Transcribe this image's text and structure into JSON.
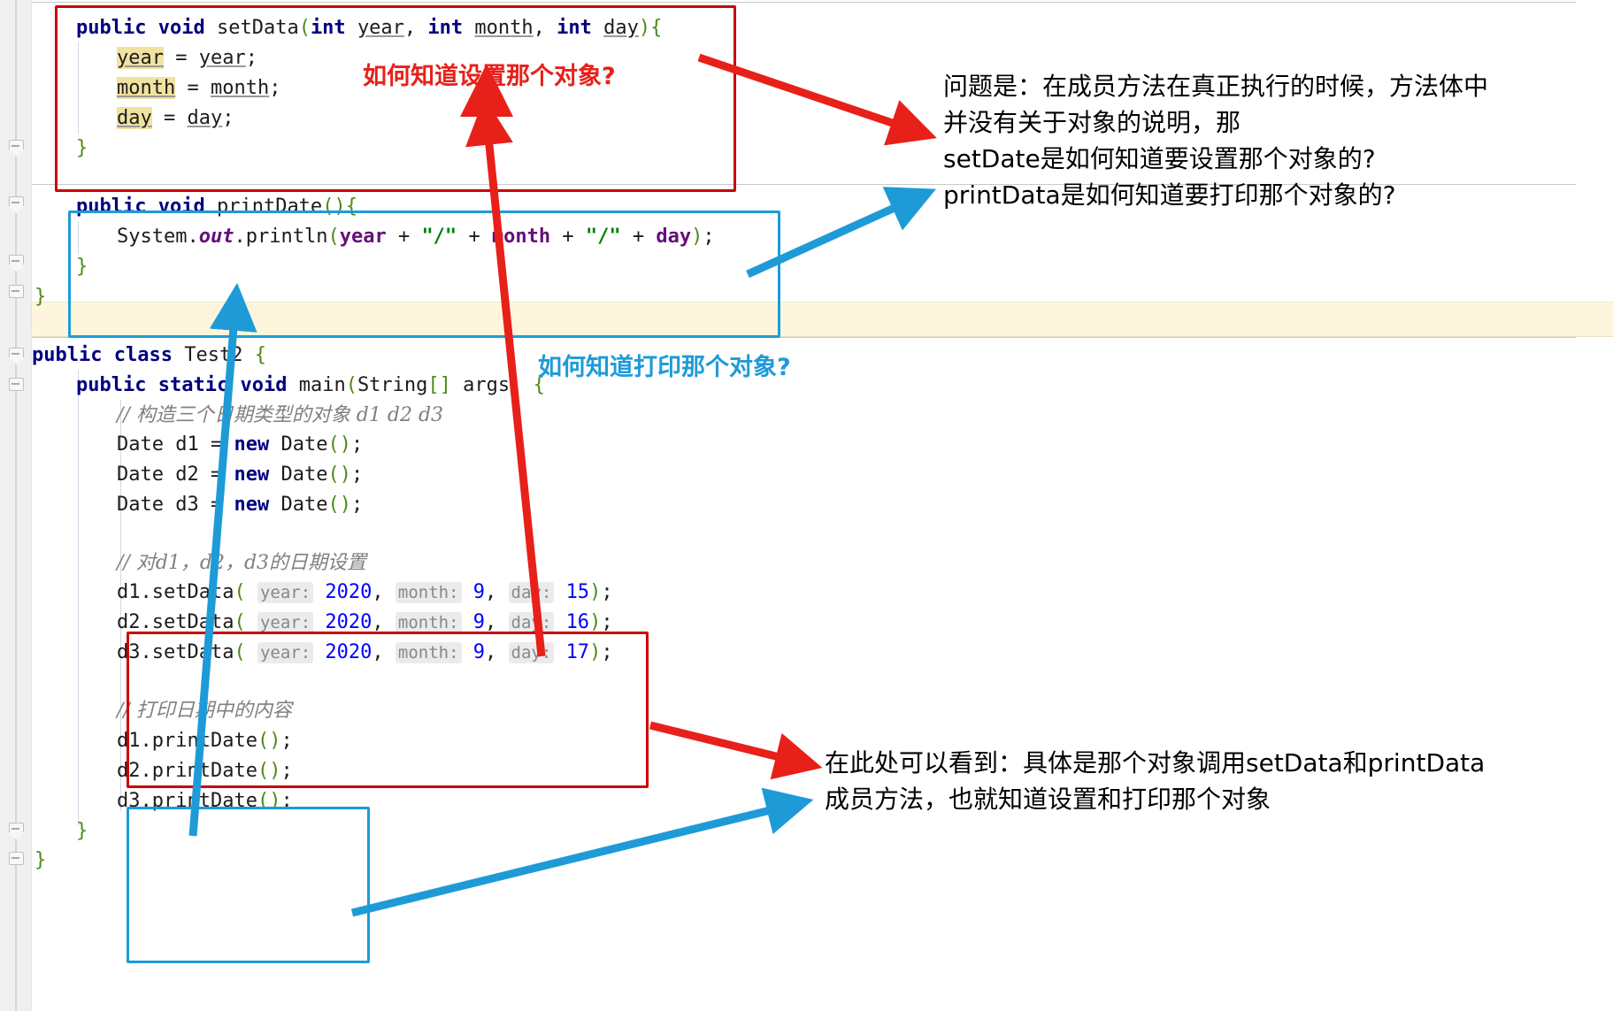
{
  "editor": {
    "code_lines": [
      {
        "id": "l1",
        "text": "public void setData(int year, int month, int day){"
      },
      {
        "id": "l2",
        "text": "    year = year;"
      },
      {
        "id": "l3",
        "text": "    month = month;"
      },
      {
        "id": "l4",
        "text": "    day = day;"
      },
      {
        "id": "l5",
        "text": "}"
      },
      {
        "id": "l6",
        "text": "public void printDate(){"
      },
      {
        "id": "l7",
        "text": "    System.out.println(year + \"/\" + month + \"/\" + day);"
      },
      {
        "id": "l8",
        "text": "}"
      },
      {
        "id": "l9",
        "text": "}"
      },
      {
        "id": "l10",
        "text": "public class Test2 {"
      },
      {
        "id": "l11",
        "text": "    public static void main(String[] args) {"
      },
      {
        "id": "l12",
        "text": "        // 构造三个日期类型的对象 d1 d2 d3"
      },
      {
        "id": "l13",
        "text": "        Date d1 = new Date();"
      },
      {
        "id": "l14",
        "text": "        Date d2 = new Date();"
      },
      {
        "id": "l15",
        "text": "        Date d3 = new Date();"
      },
      {
        "id": "l16",
        "text": "        // 对d1，d2，d3的日期设置"
      },
      {
        "id": "l17",
        "text": "        d1.setData( year: 2020, month: 9, day: 15);"
      },
      {
        "id": "l18",
        "text": "        d2.setData( year: 2020, month: 9, day: 16);"
      },
      {
        "id": "l19",
        "text": "        d3.setData( year: 2020, month: 9, day: 17);"
      },
      {
        "id": "l20",
        "text": "        // 打印日期中的内容"
      },
      {
        "id": "l21",
        "text": "        d1.printDate();"
      },
      {
        "id": "l22",
        "text": "        d2.printDate();"
      },
      {
        "id": "l23",
        "text": "        d3.printDate();"
      },
      {
        "id": "l24",
        "text": "    }"
      },
      {
        "id": "l25",
        "text": "}"
      }
    ],
    "tokens": {
      "public": "public",
      "void": "void",
      "static": "static",
      "class": "class",
      "new": "new",
      "int": "int",
      "setData": "setData",
      "printDate": "printDate",
      "year": "year",
      "month": "month",
      "day": "day",
      "System": "System",
      "out": "out",
      "println": "println",
      "Test2": "Test2",
      "main": "main",
      "String": "String",
      "args": "args",
      "Date": "Date",
      "d1": "d1",
      "d2": "d2",
      "d3": "d3",
      "slash_string": "\"/\"",
      "semi": ";",
      "plus": "+",
      "eq": "=",
      "obrace": "{",
      "cbrace": "}",
      "oparen": "(",
      "cparen": ")",
      "parens": "()",
      "brackets": "[]",
      "comma": ",",
      "dot": "."
    },
    "param_hints": {
      "year": "year:",
      "month": "month:",
      "day": "day:"
    },
    "values": {
      "year_2020": "2020",
      "month_9": "9",
      "day_15": "15",
      "day_16": "16",
      "day_17": "17"
    },
    "comments": {
      "construct": "// 构造三个日期类型的对象 d1 d2 d3",
      "set_dates": "// 对d1，d2，d3的日期设置",
      "print_dates": "// 打印日期中的内容"
    }
  },
  "annotations": {
    "red_label_top": "如何知道设置那个对象?",
    "blue_label_mid": "如何知道打印那个对象?",
    "black_note_right": "问题是：在成员方法在真正执行的时候，方法体中\n并没有关于对象的说明，那\nsetDate是如何知道要设置那个对象的?\nprintData是如何知道要打印那个对象的?",
    "black_note_bottom": "在此处可以看到：具体是那个对象调用setData和printData\n成员方法，也就知道设置和打印那个对象"
  },
  "colors": {
    "red": "#e8201a",
    "blue": "#1e9bd7",
    "keyword": "#000080",
    "field": "#660e7a",
    "number": "#0000ff",
    "string": "#008000",
    "comment": "#808080",
    "paren": "#4a8b16",
    "highlight": "#f0e2a0",
    "caret_band": "#fdf6dd",
    "gutter": "#f0f0f0"
  }
}
